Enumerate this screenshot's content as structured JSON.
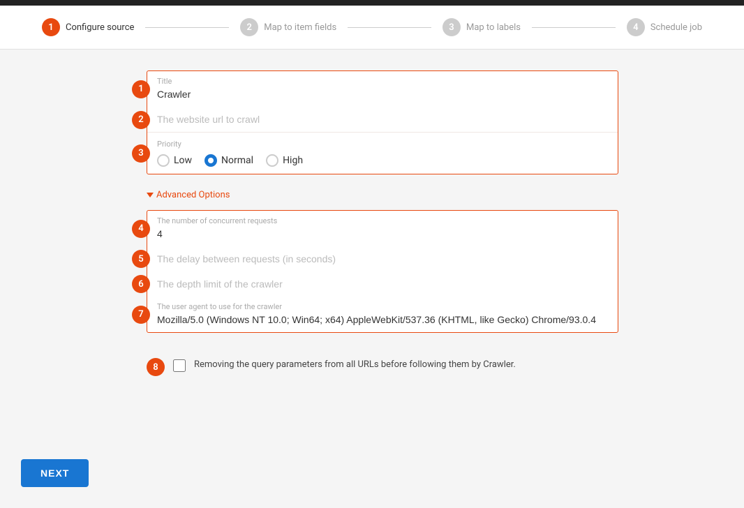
{
  "topbar": {
    "height": 8
  },
  "stepper": {
    "steps": [
      {
        "number": "1",
        "label": "Configure source",
        "active": true
      },
      {
        "number": "2",
        "label": "Map to item fields",
        "active": false
      },
      {
        "number": "3",
        "label": "Map to labels",
        "active": false
      },
      {
        "number": "4",
        "label": "Schedule job",
        "active": false
      }
    ]
  },
  "form": {
    "fields": [
      {
        "badge": "1",
        "label": "Title",
        "value": "Crawler",
        "placeholder": ""
      },
      {
        "badge": "2",
        "label": "",
        "value": "",
        "placeholder": "The website url to crawl"
      }
    ],
    "priority": {
      "badge": "3",
      "label": "Priority",
      "options": [
        "Low",
        "Normal",
        "High"
      ],
      "selected": "Normal"
    }
  },
  "advanced": {
    "toggle_label": "Advanced Options",
    "fields": [
      {
        "badge": "4",
        "label": "The number of concurrent requests",
        "value": "4",
        "placeholder": ""
      },
      {
        "badge": "5",
        "label": "",
        "value": "",
        "placeholder": "The delay between requests (in seconds)"
      },
      {
        "badge": "6",
        "label": "",
        "value": "",
        "placeholder": "The depth limit of the crawler"
      },
      {
        "badge": "7",
        "label": "The user agent to use for the crawler",
        "value": "Mozilla/5.0 (Windows NT 10.0; Win64; x64) AppleWebKit/537.36 (KHTML, like Gecko) Chrome/93.0.4",
        "placeholder": ""
      }
    ]
  },
  "checkbox": {
    "badge": "8",
    "label": "Removing the query parameters from all URLs before following them by Crawler.",
    "checked": false
  },
  "next_button": {
    "label": "NEXT"
  },
  "colors": {
    "accent": "#e8490f",
    "blue": "#1976d2"
  }
}
